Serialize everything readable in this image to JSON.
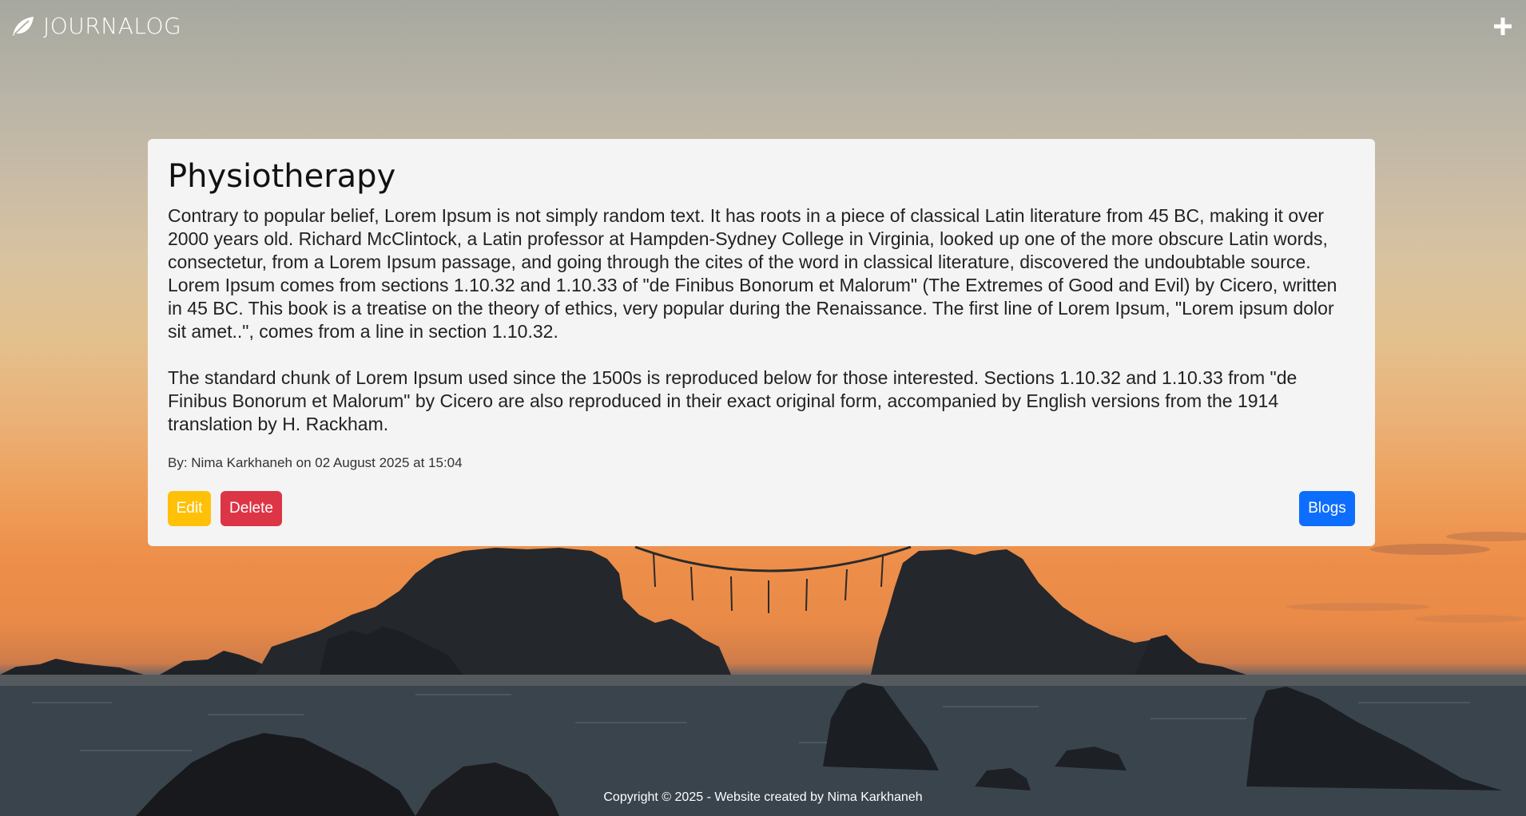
{
  "navbar": {
    "brand": "JOURNALOG",
    "brand_icon": "leaf-icon",
    "add_icon": "plus-icon"
  },
  "post": {
    "title": "Physiotherapy",
    "paragraphs": [
      "Contrary to popular belief, Lorem Ipsum is not simply random text. It has roots in a piece of classical Latin literature from 45 BC, making it over 2000 years old. Richard McClintock, a Latin professor at Hampden-Sydney College in Virginia, looked up one of the more obscure Latin words, consectetur, from a Lorem Ipsum passage, and going through the cites of the word in classical literature, discovered the undoubtable source. Lorem Ipsum comes from sections 1.10.32 and 1.10.33 of \"de Finibus Bonorum et Malorum\" (The Extremes of Good and Evil) by Cicero, written in 45 BC. This book is a treatise on the theory of ethics, very popular during the Renaissance. The first line of Lorem Ipsum, \"Lorem ipsum dolor sit amet..\", comes from a line in section 1.10.32.",
      "The standard chunk of Lorem Ipsum used since the 1500s is reproduced below for those interested. Sections 1.10.32 and 1.10.33 from \"de Finibus Bonorum et Malorum\" by Cicero are also reproduced in their exact original form, accompanied by English versions from the 1914 translation by H. Rackham."
    ],
    "byline": "By: Nima Karkhaneh on 02 August 2025 at 15:04"
  },
  "actions": {
    "edit_label": "Edit",
    "delete_label": "Delete",
    "blogs_label": "Blogs"
  },
  "colors": {
    "edit": "#ffc107",
    "delete": "#dc3545",
    "blogs": "#0d6efd"
  },
  "footer": {
    "text": "Copyright © 2025 - Website created by Nima Karkhaneh"
  }
}
